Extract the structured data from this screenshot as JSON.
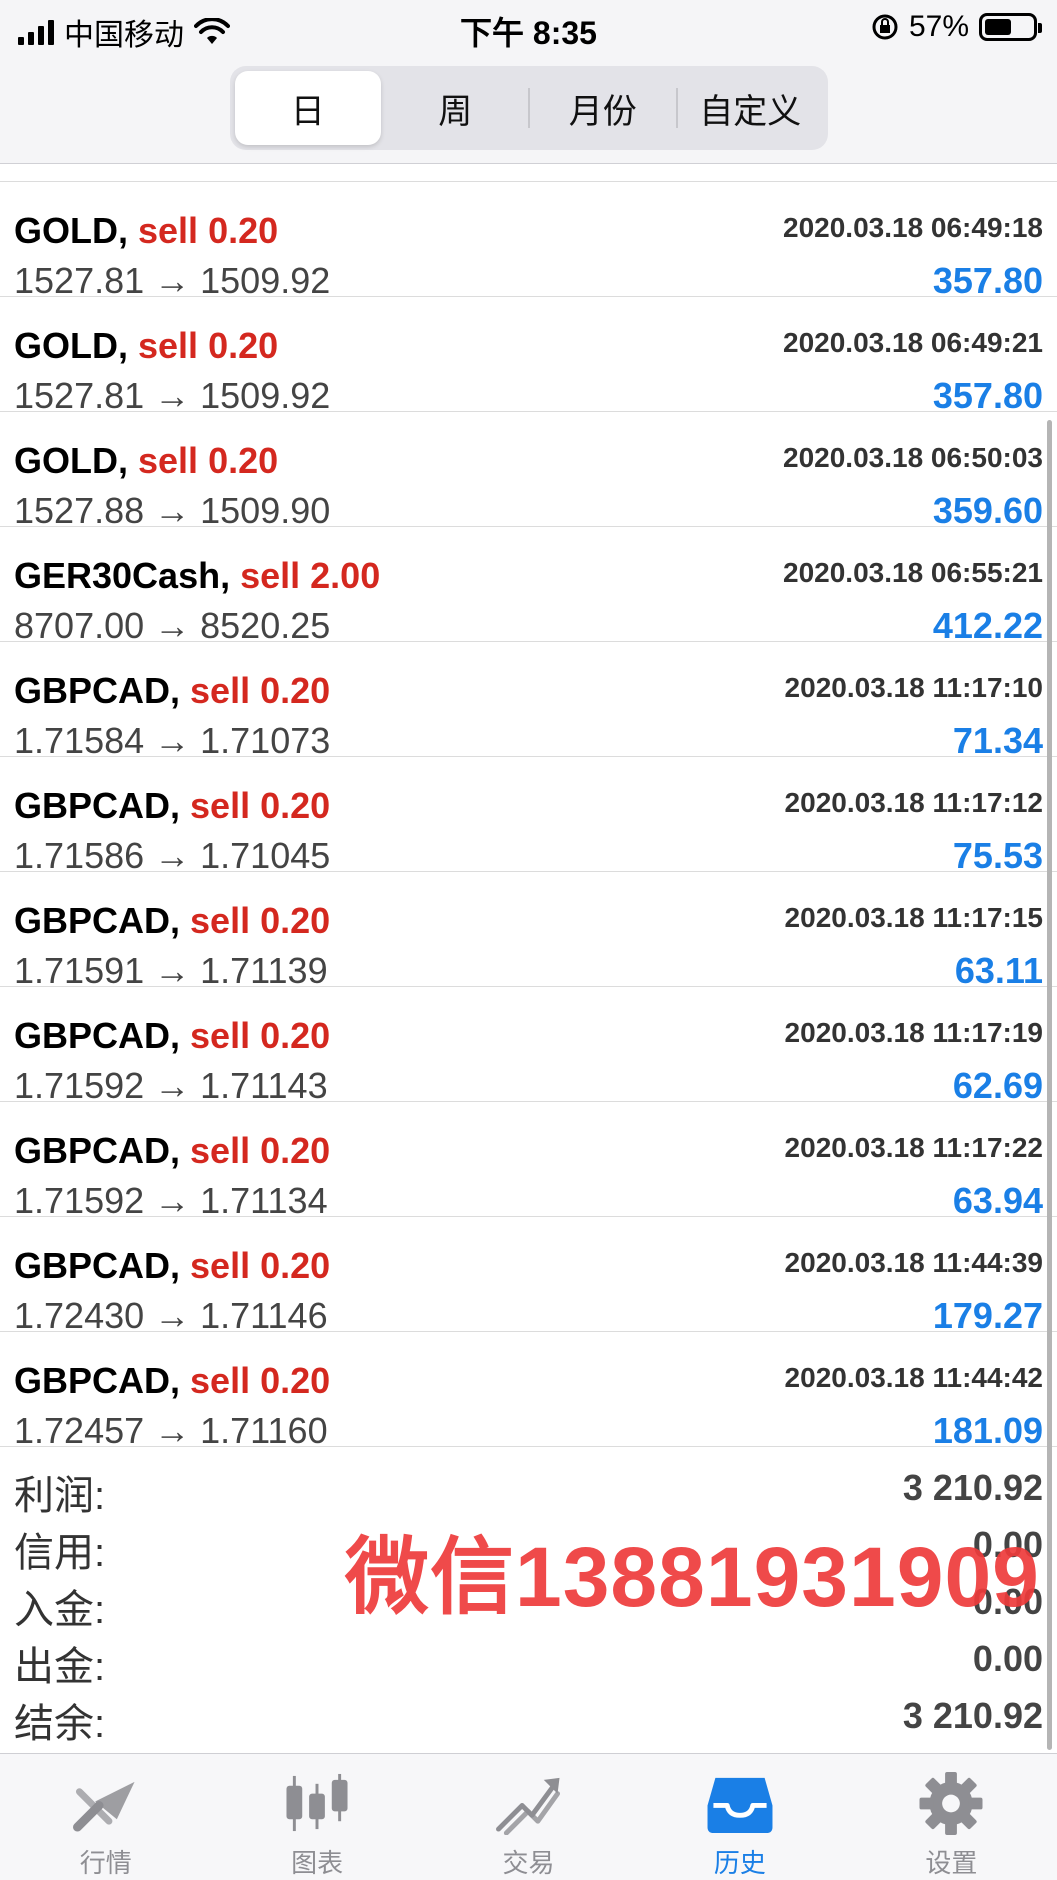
{
  "status_bar": {
    "carrier": "中国移动",
    "time": "下午 8:35",
    "battery": "57%",
    "battery_level": 0.57
  },
  "segments": [
    {
      "label": "日",
      "active": true
    },
    {
      "label": "周",
      "active": false
    },
    {
      "label": "月份",
      "active": false
    },
    {
      "label": "自定义",
      "active": false
    }
  ],
  "trades": [
    {
      "symbol": "GOLD,",
      "side": "sell 0.20",
      "time": "2020.03.18 06:49:18",
      "prices": "1527.81 → 1509.92",
      "profit": "357.80"
    },
    {
      "symbol": "GOLD,",
      "side": "sell 0.20",
      "time": "2020.03.18 06:49:21",
      "prices": "1527.81 → 1509.92",
      "profit": "357.80"
    },
    {
      "symbol": "GOLD,",
      "side": "sell 0.20",
      "time": "2020.03.18 06:50:03",
      "prices": "1527.88 → 1509.90",
      "profit": "359.60"
    },
    {
      "symbol": "GER30Cash,",
      "side": "sell 2.00",
      "time": "2020.03.18 06:55:21",
      "prices": "8707.00 → 8520.25",
      "profit": "412.22"
    },
    {
      "symbol": "GBPCAD,",
      "side": "sell 0.20",
      "time": "2020.03.18 11:17:10",
      "prices": "1.71584 → 1.71073",
      "profit": "71.34"
    },
    {
      "symbol": "GBPCAD,",
      "side": "sell 0.20",
      "time": "2020.03.18 11:17:12",
      "prices": "1.71586 → 1.71045",
      "profit": "75.53"
    },
    {
      "symbol": "GBPCAD,",
      "side": "sell 0.20",
      "time": "2020.03.18 11:17:15",
      "prices": "1.71591 → 1.71139",
      "profit": "63.11"
    },
    {
      "symbol": "GBPCAD,",
      "side": "sell 0.20",
      "time": "2020.03.18 11:17:19",
      "prices": "1.71592 → 1.71143",
      "profit": "62.69"
    },
    {
      "symbol": "GBPCAD,",
      "side": "sell 0.20",
      "time": "2020.03.18 11:17:22",
      "prices": "1.71592 → 1.71134",
      "profit": "63.94"
    },
    {
      "symbol": "GBPCAD,",
      "side": "sell 0.20",
      "time": "2020.03.18 11:44:39",
      "prices": "1.72430 → 1.71146",
      "profit": "179.27"
    },
    {
      "symbol": "GBPCAD,",
      "side": "sell 0.20",
      "time": "2020.03.18 11:44:42",
      "prices": "1.72457 → 1.71160",
      "profit": "181.09"
    }
  ],
  "summary": [
    {
      "label": "利润:",
      "value": "3 210.92"
    },
    {
      "label": "信用:",
      "value": "0.00"
    },
    {
      "label": "入金:",
      "value": "0.00"
    },
    {
      "label": "出金:",
      "value": "0.00"
    },
    {
      "label": "结余:",
      "value": "3 210.92"
    }
  ],
  "watermark": "微信13881931909",
  "tabs": [
    {
      "label": "行情",
      "icon": "quotes-icon",
      "active": false
    },
    {
      "label": "图表",
      "icon": "chart-icon",
      "active": false
    },
    {
      "label": "交易",
      "icon": "trade-icon",
      "active": false
    },
    {
      "label": "历史",
      "icon": "history-icon",
      "active": true
    },
    {
      "label": "设置",
      "icon": "settings-icon",
      "active": false
    }
  ],
  "colors": {
    "sell": "#d4281f",
    "profit": "#1a7fe6",
    "tab_active": "#1a7fe6",
    "tab_inactive": "#8e8e93"
  }
}
